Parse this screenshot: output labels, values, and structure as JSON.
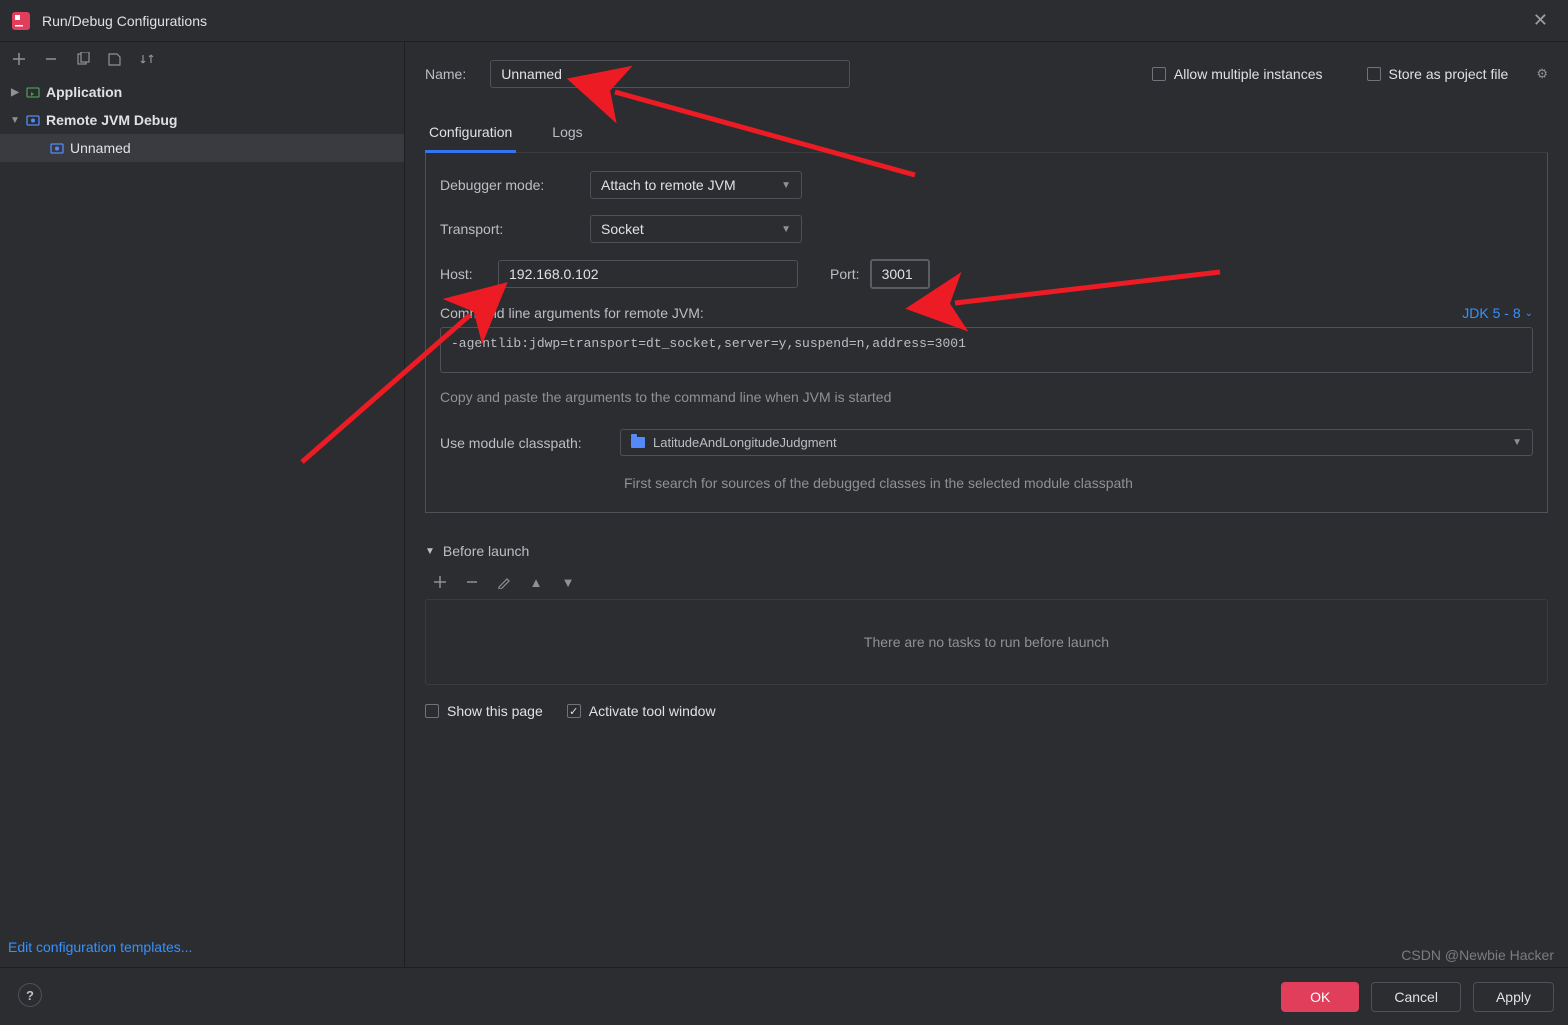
{
  "window": {
    "title": "Run/Debug Configurations"
  },
  "tree": {
    "application": "Application",
    "remote_jvm": "Remote JVM Debug",
    "unnamed": "Unnamed"
  },
  "templates_link": "Edit configuration templates...",
  "form": {
    "name_label": "Name:",
    "name_value": "Unnamed",
    "allow_multi": "Allow multiple instances",
    "store_project": "Store as project file"
  },
  "tabs": {
    "configuration": "Configuration",
    "logs": "Logs"
  },
  "config": {
    "debugger_mode_label": "Debugger mode:",
    "debugger_mode_value": "Attach to remote JVM",
    "transport_label": "Transport:",
    "transport_value": "Socket",
    "host_label": "Host:",
    "host_value": "192.168.0.102",
    "port_label": "Port:",
    "port_value": "3001",
    "cmdline_label": "Command line arguments for remote JVM:",
    "jdk_label": "JDK 5 - 8",
    "cmdline_value": "-agentlib:jdwp=transport=dt_socket,server=y,suspend=n,address=3001",
    "cmdline_hint": "Copy and paste the arguments to the command line when JVM is started",
    "module_label": "Use module classpath:",
    "module_value": "LatitudeAndLongitudeJudgment",
    "module_hint": "First search for sources of the debugged classes in the selected module classpath"
  },
  "before_launch": {
    "title": "Before launch",
    "empty": "There are no tasks to run before launch"
  },
  "bottom": {
    "show_page": "Show this page",
    "activate_tool": "Activate tool window"
  },
  "buttons": {
    "ok": "OK",
    "cancel": "Cancel",
    "apply": "Apply"
  },
  "watermark": "CSDN @Newbie Hacker"
}
